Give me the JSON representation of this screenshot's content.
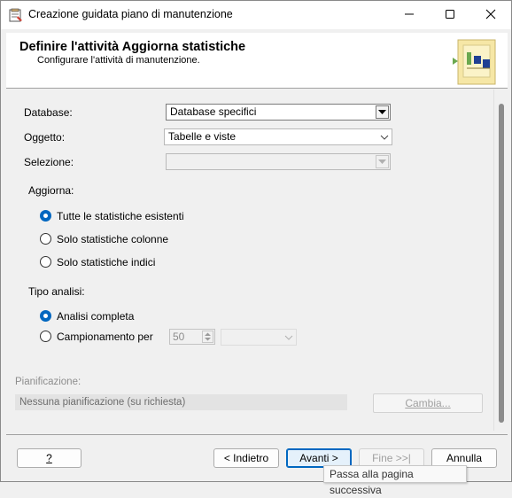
{
  "window": {
    "title": "Creazione guidata piano di manutenzione",
    "minimize_icon": "minimize-icon",
    "maximize_icon": "maximize-icon",
    "close_icon": "close-icon"
  },
  "header": {
    "title": "Definire l'attività Aggiorna statistiche",
    "subtitle": "Configurare l'attività di manutenzione."
  },
  "form": {
    "database": {
      "label": "Database:",
      "value": "Database specifici"
    },
    "oggetto": {
      "label": "Oggetto:",
      "value": "Tabelle e viste"
    },
    "selezione": {
      "label": "Selezione:",
      "value": ""
    },
    "aggiorna": {
      "label": "Aggiorna:",
      "options": [
        {
          "label": "Tutte le statistiche esistenti",
          "checked": true
        },
        {
          "label": "Solo statistiche colonne",
          "checked": false
        },
        {
          "label": "Solo statistiche indici",
          "checked": false
        }
      ]
    },
    "tipo_analisi": {
      "label": "Tipo analisi:",
      "options": [
        {
          "label": "Analisi completa",
          "checked": true
        },
        {
          "label": "Campionamento per",
          "checked": false
        }
      ],
      "sample_value": "50",
      "sample_unit": ""
    },
    "pianificazione": {
      "label": "Pianificazione:",
      "value": "Nessuna pianificazione (su richiesta)",
      "change_button": "Cambia..."
    }
  },
  "footer": {
    "help_button": "?",
    "back_button": "< Indietro",
    "next_button": "Avanti >",
    "finish_button": "Fine >>|",
    "cancel_button": "Annulla"
  },
  "tooltip": "Passa alla pagina successiva",
  "colors": {
    "accent": "#0067c0",
    "background": "#f0f0f0"
  }
}
